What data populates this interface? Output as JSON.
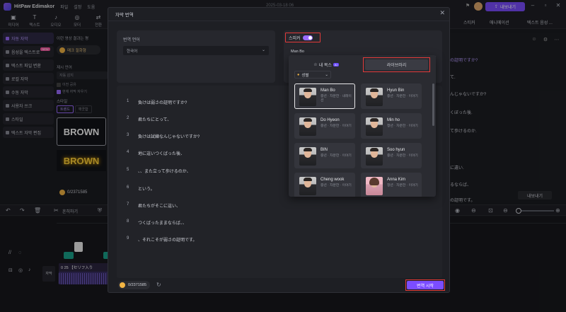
{
  "app": {
    "title": "HitPaw Edimakor",
    "menu": [
      "파일",
      "설정",
      "도움"
    ],
    "datetime": "2025-03-18 06",
    "export_label": "내보내기"
  },
  "toolbar": {
    "tools": [
      "미디어",
      "텍스트",
      "오디오",
      "모더",
      "전환"
    ],
    "right_tabs": [
      "스티커",
      "애니메이션",
      "텍스트 음성 ..."
    ]
  },
  "left_nav": {
    "items": [
      {
        "label": "자동 자막",
        "active": true
      },
      {
        "label": "음성을 텍스트로",
        "badge": "NEW"
      },
      {
        "label": "텍스트 파일 변환"
      },
      {
        "label": "로컬 자막"
      },
      {
        "label": "수동 자막"
      },
      {
        "label": "사용자 쓰크"
      },
      {
        "label": "스타일"
      },
      {
        "label": "텍스트 자막 편집"
      }
    ]
  },
  "left_panel": {
    "note": "이런 영상 결과는 평",
    "chip_label": "매크 절화형",
    "lang_label": "제시 언어",
    "lang_value": "자동 감지",
    "check1": "이전 공유",
    "check2": "현재 자막 자우기",
    "style_label": "스타일",
    "style_tabs": [
      "트렌드",
      "깨끗함"
    ],
    "preview1": "BROWN",
    "preview2": "BROWN",
    "credits": "0/2371585"
  },
  "right_panel": {
    "lines": [
      "の証明ですか?",
      "て.",
      "んじゃないですか?",
      "くぼった後.",
      "て歩けるのか.",
      "に違い.",
      "るならば、",
      "の証明です。"
    ],
    "export_label": "내보내기"
  },
  "timeline": {
    "undo": "↶",
    "split_label": "흔히하기",
    "track_label": "자막",
    "clip_title": "0 25 【セリフ入り"
  },
  "dialog": {
    "title": "자막 번역",
    "source_label": "번역 언어",
    "source_value": "한국어",
    "speaker_label": "스피커",
    "speaker_value": "Man Bo",
    "lines": [
      {
        "num": "1",
        "text": "負けは弱さの証明ですか?"
      },
      {
        "num": "2",
        "text": "君たちにとって、"
      },
      {
        "num": "3",
        "text": "負けは試練なんじゃないですか?"
      },
      {
        "num": "4",
        "text": "地に這いつくばった後、"
      },
      {
        "num": "5",
        "text": "、、また立って歩けるのか、"
      },
      {
        "num": "6",
        "text": "という。"
      },
      {
        "num": "7",
        "text": "君たちがそこに這い、"
      },
      {
        "num": "8",
        "text": "つくばったままならば、、"
      },
      {
        "num": "9",
        "text": "、それこそが弱さの証明です。"
      }
    ],
    "credits": "0/2371585",
    "start_label": "번역 시작"
  },
  "dropdown": {
    "tab_mine": "내 복스",
    "tab_mine_badge": "AI",
    "tab_library": "라이브러리",
    "filter_label": "성별",
    "voices": [
      {
        "name": "Man Bo",
        "meta": "중년 · 차분한 · 내레이션",
        "selected": true,
        "female": false
      },
      {
        "name": "Hyun Bin",
        "meta": "중년 · 차분한 · 이야기",
        "female": false
      },
      {
        "name": "Do Hyeon",
        "meta": "중년 · 차분한 · 이야기",
        "female": false
      },
      {
        "name": "Min ho",
        "meta": "청년 · 차분한 · 이야기",
        "female": false
      },
      {
        "name": "BIN",
        "meta": "중년 · 차분한 · 이야기",
        "female": false
      },
      {
        "name": "Soo hyun",
        "meta": "중년 · 차분한 · 이야기",
        "female": false
      },
      {
        "name": "Cheng wook",
        "meta": "중년 · 차분한 · 이야기",
        "female": false
      },
      {
        "name": "Anna Kim",
        "meta": "청년 · 차분한 · 이야기",
        "female": true
      }
    ]
  }
}
